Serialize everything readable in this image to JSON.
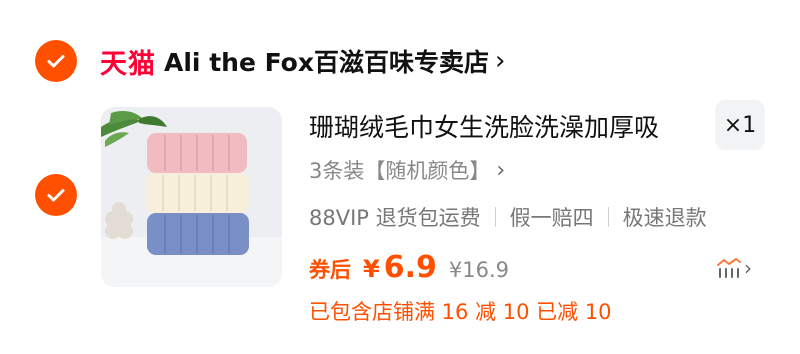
{
  "store": {
    "brand_logo_text": "天猫",
    "name": "Ali the Fox百滋百味专卖店",
    "chevron": "›"
  },
  "item": {
    "title": "珊瑚绒毛巾女生洗脸洗澡加厚吸",
    "quantity": "×1",
    "sku": "3条装【随机颜色】",
    "sku_chevron": "›",
    "services": [
      "88VIP 退货包运费",
      "假一赔四",
      "极速退款"
    ],
    "coupon_label": "券后",
    "currency": "¥",
    "price": "6.9",
    "original_price": "¥16.9",
    "promo_text": "已包含店铺满 16 减 10 已减 10",
    "trend_chevron": "›"
  },
  "colors": {
    "accent": "#ff5000",
    "tmall_red": "#ff0036",
    "muted_text": "#888888"
  },
  "icons": [
    "check-icon",
    "chevron-right-icon",
    "price-trend-icon"
  ]
}
